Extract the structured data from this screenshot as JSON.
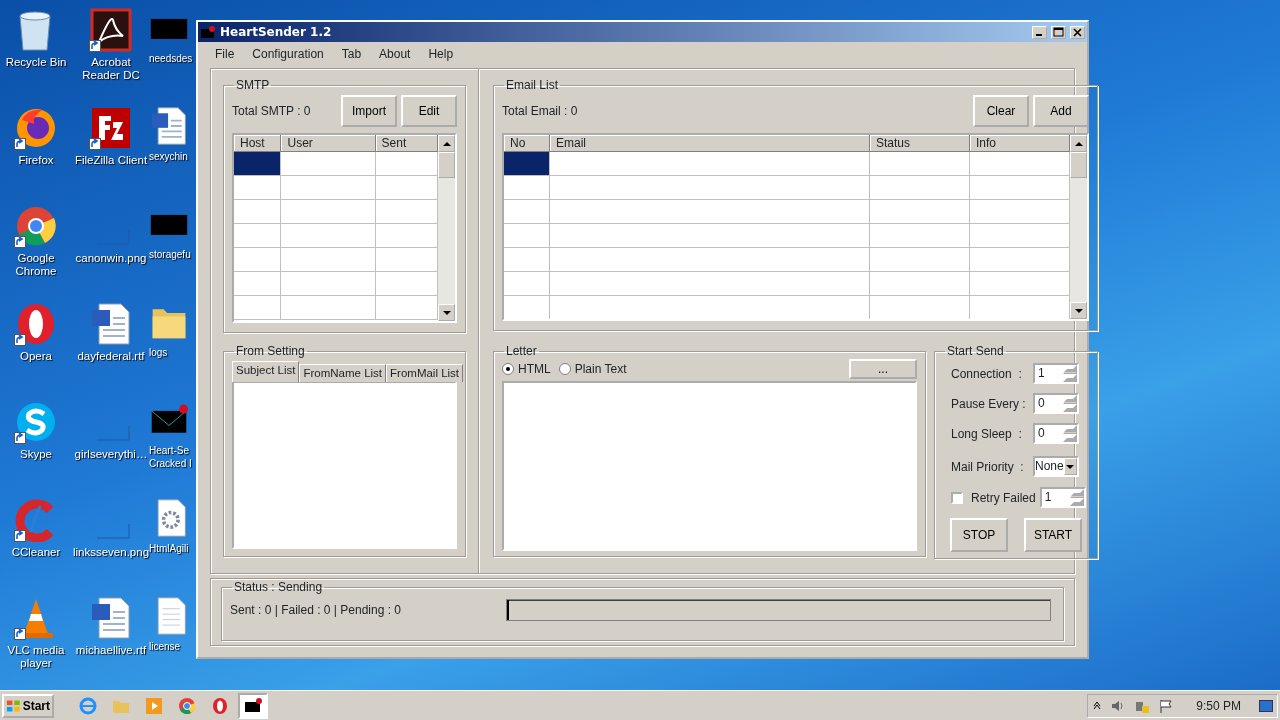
{
  "desktop": {
    "icons": [
      {
        "label": "Recycle Bin",
        "kind": "bin",
        "shortcut": false
      },
      {
        "label": "Firefox",
        "kind": "firefox",
        "shortcut": true
      },
      {
        "label": "Google Chrome",
        "kind": "chrome",
        "shortcut": true
      },
      {
        "label": "Opera",
        "kind": "opera",
        "shortcut": true
      },
      {
        "label": "Skype",
        "kind": "skype",
        "shortcut": true
      },
      {
        "label": "CCleaner",
        "kind": "ccleaner",
        "shortcut": true
      },
      {
        "label": "VLC media player",
        "kind": "vlc",
        "shortcut": true
      },
      {
        "label": "Acrobat Reader DC",
        "kind": "pdf",
        "shortcut": true
      },
      {
        "label": "FileZilla Client",
        "kind": "filezilla",
        "shortcut": true
      },
      {
        "label": "canonwin.png",
        "kind": "blank",
        "shortcut": false
      },
      {
        "label": "dayfederal.rtf",
        "kind": "word",
        "shortcut": false
      },
      {
        "label": "girlseverythi…",
        "kind": "blank",
        "shortcut": false
      },
      {
        "label": "linksseven.png",
        "kind": "blank",
        "shortcut": false
      },
      {
        "label": "michaellive.rtf",
        "kind": "word",
        "shortcut": false
      },
      {
        "label": "needsdes",
        "kind": "black",
        "shortcut": false
      },
      {
        "label": "sexychin",
        "kind": "word",
        "shortcut": false
      },
      {
        "label": "storagefu",
        "kind": "black",
        "shortcut": false
      },
      {
        "label": "logs",
        "kind": "folder",
        "shortcut": false
      },
      {
        "label": "Heart-Se\nCracked I",
        "kind": "mail",
        "shortcut": false
      },
      {
        "label": "HtmlAgili",
        "kind": "gear",
        "shortcut": false
      },
      {
        "label": "license",
        "kind": "doc",
        "shortcut": false
      }
    ]
  },
  "window": {
    "title": "HeartSender 1.2",
    "menu": [
      "File",
      "Configuration",
      "Tab",
      "About",
      "Help"
    ],
    "smtp": {
      "title": "SMTP",
      "total": "Total SMTP : 0",
      "buttons": [
        "Import",
        "Edit"
      ],
      "table": {
        "columns": [
          "Host",
          "User",
          "Sent"
        ],
        "rows": [
          {
            "selected": true
          },
          {
            "selected": false
          },
          {
            "selected": false
          },
          {
            "selected": false
          },
          {
            "selected": false
          },
          {
            "selected": false
          },
          {
            "selected": false
          }
        ]
      }
    },
    "from_setting": {
      "title": "From Setting",
      "tabs": [
        {
          "label": "Subject List",
          "selected": true
        },
        {
          "label": "FromName List",
          "selected": false
        },
        {
          "label": "FromMail List",
          "selected": false
        }
      ]
    },
    "email_list": {
      "title": "Email List",
      "total": "Total Email : 0",
      "buttons": [
        "Clear",
        "Add"
      ],
      "table": {
        "columns": [
          "No",
          "Email",
          "Status",
          "Info"
        ],
        "rows": [
          {
            "selected": true
          },
          {
            "selected": false
          },
          {
            "selected": false
          },
          {
            "selected": false
          },
          {
            "selected": false
          },
          {
            "selected": false
          },
          {
            "selected": false
          }
        ]
      }
    },
    "letter": {
      "title": "Letter",
      "formats": [
        {
          "label": "HTML",
          "selected": true
        },
        {
          "label": "Plain Text",
          "selected": false
        }
      ],
      "browse_button": "..."
    },
    "start_send": {
      "title": "Start Send",
      "fields": [
        {
          "kind": "spin",
          "label": "Connection  :",
          "value": "1"
        },
        {
          "kind": "spin",
          "label": "Pause Every :",
          "value": "0"
        },
        {
          "kind": "spin",
          "label": "Long Sleep  :",
          "value": "0"
        },
        {
          "kind": "select",
          "label": "Mail Priority  :",
          "value": "None"
        },
        {
          "kind": "check",
          "label": "Retry Failed",
          "checked": false,
          "value": "1"
        }
      ],
      "buttons": [
        "STOP",
        "START"
      ]
    },
    "status": {
      "title": "Status : Sending",
      "summary": "Sent : 0 | Failed : 0 | Pending : 0",
      "progress": {
        "level": 0
      }
    }
  },
  "taskbar": {
    "start": "Start",
    "apps": [
      {
        "kind": "ie",
        "active": false
      },
      {
        "kind": "explorer",
        "active": false
      },
      {
        "kind": "media",
        "active": false
      },
      {
        "kind": "chrome",
        "active": false
      },
      {
        "kind": "opera",
        "active": false
      },
      {
        "kind": "mail",
        "active": true
      }
    ],
    "clock": "9:50 PM"
  }
}
